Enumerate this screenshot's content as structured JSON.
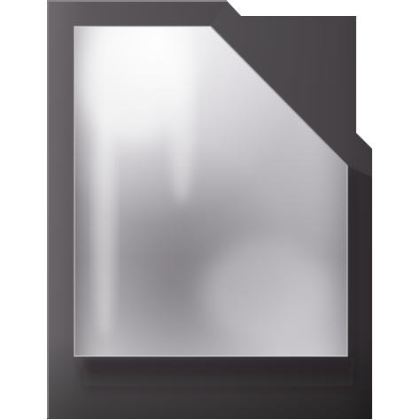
{
  "icon": {
    "name": "document-file-icon",
    "colors": {
      "frame_dark": "#3b3739",
      "frame_mid": "#5a5658",
      "frame_light": "#7a7679",
      "sheet_light": "#f2f1f3",
      "sheet_mid": "#b9b6bb",
      "sheet_dark": "#6f6b70"
    }
  }
}
